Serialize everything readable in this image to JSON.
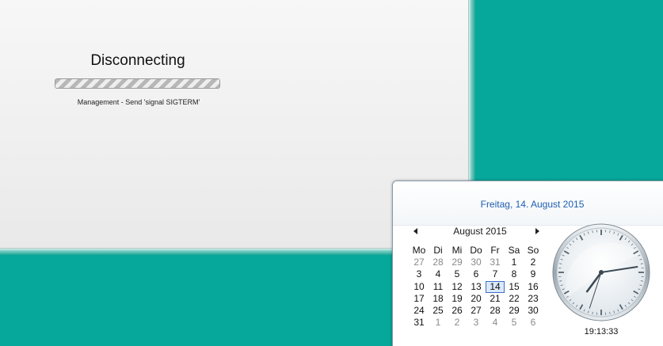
{
  "vpn": {
    "title": "Disconnecting",
    "detail": "Management - Send 'signal SIGTERM'",
    "progress_percent": 100
  },
  "calendar": {
    "header_date": "Freitag, 14. August 2015",
    "month_title": "August 2015",
    "weekdays": [
      "Mo",
      "Di",
      "Mi",
      "Do",
      "Fr",
      "Sa",
      "So"
    ],
    "weeks": [
      [
        "27",
        "28",
        "29",
        "30",
        "31",
        "1",
        "2"
      ],
      [
        "3",
        "4",
        "5",
        "6",
        "7",
        "8",
        "9"
      ],
      [
        "10",
        "11",
        "12",
        "13",
        "14",
        "15",
        "16"
      ],
      [
        "17",
        "18",
        "19",
        "20",
        "21",
        "22",
        "23"
      ],
      [
        "24",
        "25",
        "26",
        "27",
        "28",
        "29",
        "30"
      ],
      [
        "31",
        "1",
        "2",
        "3",
        "4",
        "5",
        "6"
      ]
    ],
    "today": "14"
  },
  "clock": {
    "time": "19:13:33"
  },
  "colors": {
    "desktop": "#05a89a",
    "link": "#1e5fb0",
    "today_border": "#3b6fc4"
  }
}
